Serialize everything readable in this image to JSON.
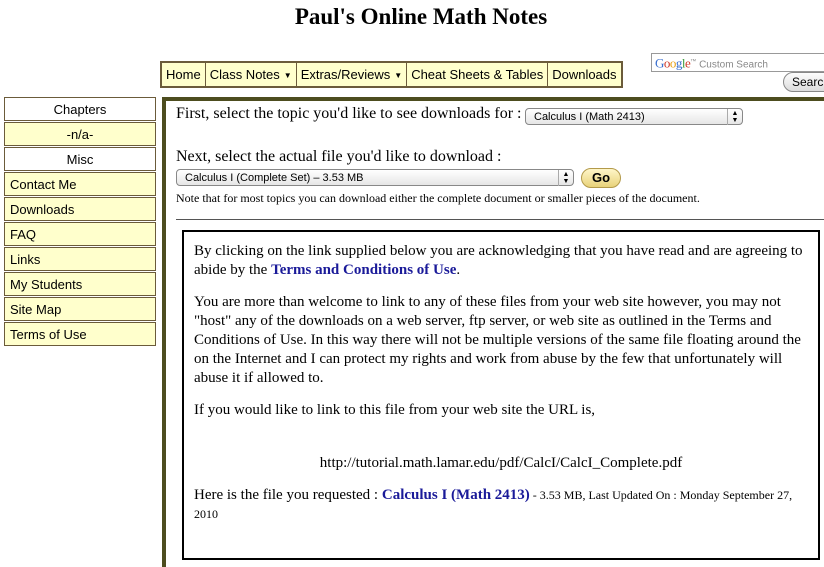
{
  "header": {
    "title": "Paul's Online Math Notes"
  },
  "nav": {
    "home": "Home",
    "class_notes": "Class Notes",
    "extras": "Extras/Reviews",
    "cheat_sheets": "Cheat Sheets & Tables",
    "downloads": "Downloads",
    "caret_icon": "▼"
  },
  "search": {
    "logo": {
      "g1": "G",
      "g2": "o",
      "g3": "o",
      "g4": "g",
      "g5": "l",
      "g6": "e"
    },
    "tm": "™",
    "placeholder": "Custom Search",
    "button": "Search"
  },
  "sidebar": {
    "chapters": "Chapters",
    "na": "-n/a-",
    "misc": "Misc",
    "items": [
      "Contact Me",
      "Downloads",
      "FAQ",
      "Links",
      "My Students",
      "Site Map",
      "Terms of Use"
    ]
  },
  "main": {
    "topic_prompt": "First, select the topic you'd like to see downloads for :",
    "topic_selected": "Calculus I (Math 2413)",
    "file_prompt": "Next, select the actual file you'd like to download :",
    "file_selected": "Calculus I (Complete Set) – 3.53 MB",
    "go": "Go",
    "note": "Note that for most topics you can download either the complete document or smaller pieces of the document.",
    "arrows_up": "▲",
    "arrows_down": "▼"
  },
  "notice": {
    "p1_before": "By clicking on the link supplied below you are acknowledging that you have read and are agreeing to abide by the ",
    "p1_link": "Terms and Conditions of Use",
    "p1_after": ".",
    "p2": "You are more than welcome to link to any of these files from your web site however, you may not \"host\" any of the downloads on a web server, ftp server, or web site as outlined in the Terms and Conditions of Use. In this way there will not be multiple versions of the same file floating around the on the Internet and I can protect my rights and work from abuse by the few that unfortunately will abuse it if allowed to.",
    "p3": "If you would like to link to this file from your web site the URL is,",
    "url": "http://tutorial.math.lamar.edu/pdf/CalcI/CalcI_Complete.pdf",
    "file_prefix": "Here is the file you requested : ",
    "file_link": "Calculus I (Math 2413)",
    "file_meta": " - 3.53 MB, Last Updated On : Monday September 27, 2010"
  }
}
